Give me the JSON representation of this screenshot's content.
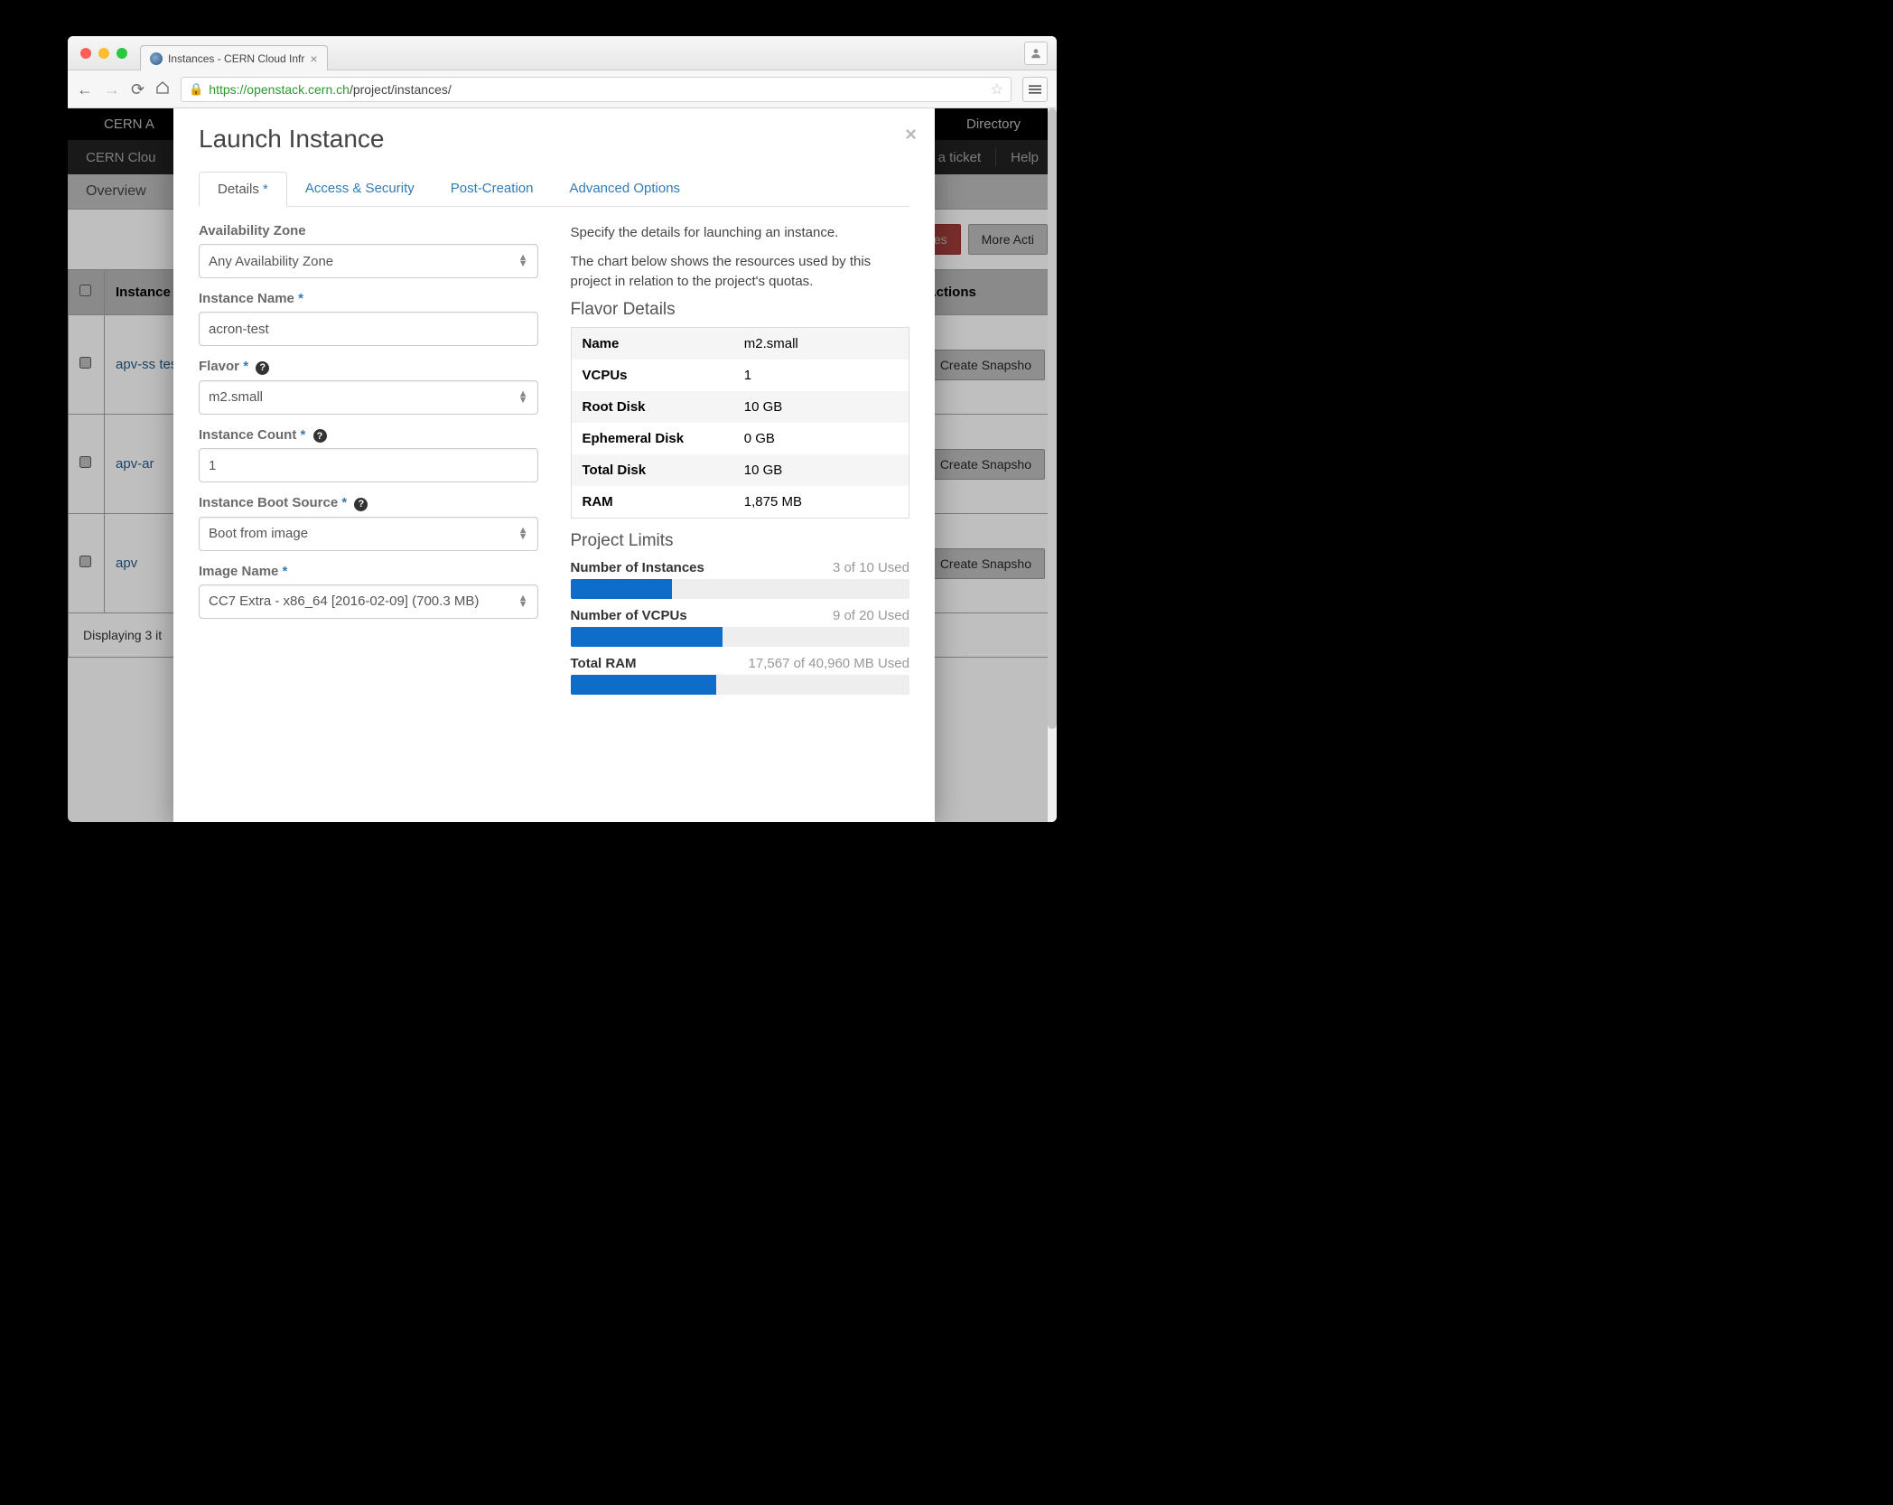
{
  "browser": {
    "tab_title": "Instances - CERN Cloud Infr",
    "url_proto": "https",
    "url_domain": "://openstack.cern.ch",
    "url_path": "/project/instances/"
  },
  "bg": {
    "nav_left": "CERN A",
    "nav_right": "Directory",
    "sub_left": "CERN Clou",
    "sub_ticket": "a ticket",
    "sub_help": "Help",
    "crumb": "Overview",
    "btn_launch_suffix": "ces",
    "btn_more": "More Acti",
    "th_check": "",
    "th_name": "Instance Name",
    "th_actions": "Actions",
    "rows": [
      {
        "name": "apv-ss test",
        "action": "Create Snapsho"
      },
      {
        "name": "apv-ar",
        "action": "Create Snapsho"
      },
      {
        "name": "apv",
        "action": "Create Snapsho"
      }
    ],
    "footer": "Displaying 3 it"
  },
  "modal": {
    "title": "Launch Instance",
    "tabs": {
      "details": "Details",
      "access": "Access & Security",
      "post": "Post-Creation",
      "adv": "Advanced Options"
    },
    "form": {
      "zone_label": "Availability Zone",
      "zone_value": "Any Availability Zone",
      "name_label": "Instance Name",
      "name_value": "acron-test",
      "flavor_label": "Flavor",
      "flavor_value": "m2.small",
      "count_label": "Instance Count",
      "count_value": "1",
      "boot_label": "Instance Boot Source",
      "boot_value": "Boot from image",
      "image_label": "Image Name",
      "image_value": "CC7 Extra - x86_64 [2016-02-09] (700.3 MB)"
    },
    "right": {
      "intro1": "Specify the details for launching an instance.",
      "intro2": "The chart below shows the resources used by this project in relation to the project's quotas.",
      "flavor_title": "Flavor Details",
      "flavor": [
        [
          "Name",
          "m2.small"
        ],
        [
          "VCPUs",
          "1"
        ],
        [
          "Root Disk",
          "10 GB"
        ],
        [
          "Ephemeral Disk",
          "0 GB"
        ],
        [
          "Total Disk",
          "10 GB"
        ],
        [
          "RAM",
          "1,875 MB"
        ]
      ],
      "limits_title": "Project Limits",
      "quotas": [
        {
          "label": "Number of Instances",
          "text": "3 of 10 Used",
          "pct": 30
        },
        {
          "label": "Number of VCPUs",
          "text": "9 of 20 Used",
          "pct": 45
        },
        {
          "label": "Total RAM",
          "text": "17,567 of 40,960 MB Used",
          "pct": 43
        }
      ]
    }
  }
}
